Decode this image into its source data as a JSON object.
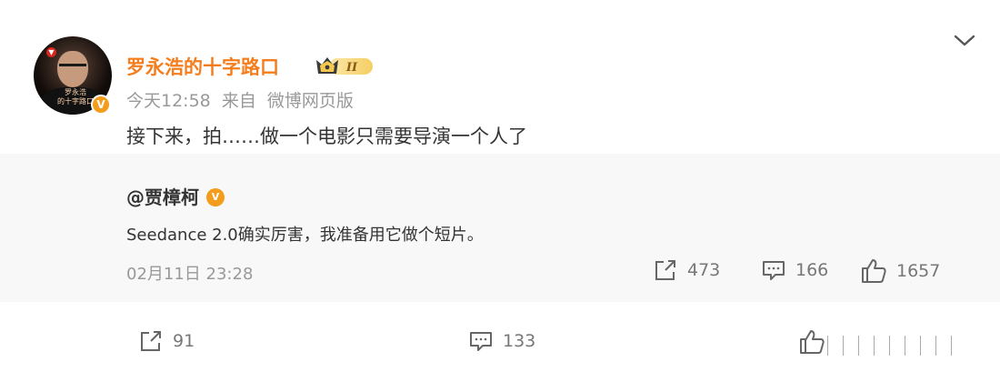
{
  "post": {
    "author": "罗永浩的十字路口",
    "author_badge_text": "II",
    "time": "今天12:58",
    "source_prefix": "来自",
    "source": "微博网页版",
    "text": "接下来，拍……做一个电影只需要导演一个人了",
    "avatar_caption": "罗永浩\n的十字路口",
    "verified_mark": "V"
  },
  "repost": {
    "mention": "@贾樟柯",
    "text": "Seedance 2.0确实厉害，我准备用它做个短片。",
    "time": "02月11日 23:28",
    "stats": {
      "reposts": "473",
      "comments": "166",
      "likes": "1657"
    }
  },
  "footer": {
    "reposts": "91",
    "comments": "133"
  },
  "colors": {
    "author_name": "#f47d1d",
    "verified_badge": "#f49c1c",
    "meta_text": "#999999",
    "repost_bg": "#f8f8f8"
  },
  "icons": [
    "chevron-down-icon",
    "repost-icon",
    "comment-icon",
    "like-icon",
    "verified-icon",
    "member-crown-icon"
  ]
}
